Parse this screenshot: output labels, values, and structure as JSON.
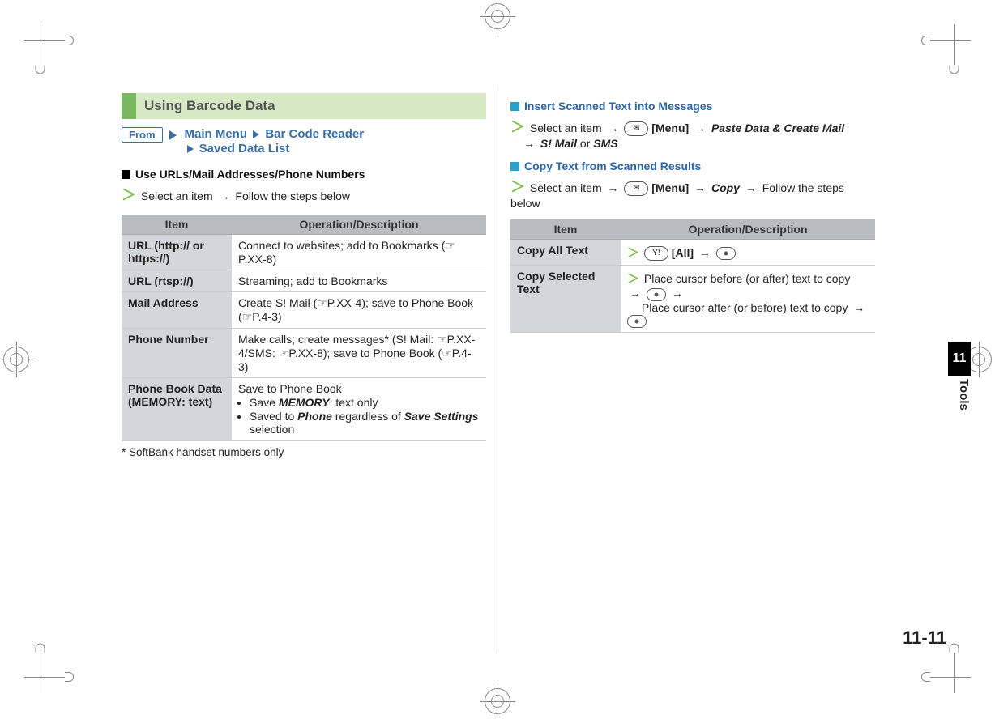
{
  "chapter": {
    "number": "11",
    "side_label": "Tools"
  },
  "page_number": "11-11",
  "section_title": "Using Barcode Data",
  "from_label": "From",
  "nav": {
    "a": "Main Menu",
    "b": "Bar Code Reader",
    "c": "Saved Data List"
  },
  "left": {
    "sub1": "Use URLs/Mail Addresses/Phone Numbers",
    "step1_a": "Select an item",
    "step1_b": "Follow the steps below",
    "footnote_mark": "*",
    "footnote": " SoftBank handset numbers only",
    "table": {
      "head_item": "Item",
      "head_desc": "Operation/Description",
      "rows": [
        {
          "item": "URL (http:// or https://)",
          "desc": "Connect to websites; add to Bookmarks (☞P.XX-8)"
        },
        {
          "item": "URL (rtsp://)",
          "desc": "Streaming; add to Bookmarks"
        },
        {
          "item": "Mail Address",
          "desc": "Create S! Mail (☞P.XX-4); save to Phone Book (☞P.4-3)"
        },
        {
          "item": "Phone Number",
          "desc": "Make calls; create messages* (S! Mail: ☞P.XX-4/SMS: ☞P.XX-8); save to Phone Book (☞P.4-3)"
        },
        {
          "item": "Phone Book Data (MEMORY: text)",
          "desc_lead": "Save to Phone Book",
          "desc_b1_a": "Save ",
          "desc_b1_b": "MEMORY",
          "desc_b1_c": ": text only",
          "desc_b2_a": "Saved to ",
          "desc_b2_b": "Phone",
          "desc_b2_c": " regardless of ",
          "desc_b2_d": "Save Settings",
          "desc_b2_e": " selection"
        }
      ]
    }
  },
  "right": {
    "sub_a": "Insert Scanned Text into Messages",
    "a_step_1": "Select an item",
    "a_menu": "[Menu]",
    "a_paste": "Paste Data & Create Mail",
    "a_smail": "S! Mail",
    "a_or": " or ",
    "a_sms": "SMS",
    "sub_b": "Copy Text from Scanned Results",
    "b_step_1": "Select an item",
    "b_menu": "[Menu]",
    "b_copy": "Copy",
    "b_step_2": "Follow the steps below",
    "table": {
      "head_item": "Item",
      "head_desc": "Operation/Description",
      "rows": [
        {
          "item": "Copy All Text",
          "all_label": "[All]"
        },
        {
          "item": "Copy Selected Text",
          "sel_a": "Place cursor before (or after) text to copy",
          "sel_b": "Place cursor after (or before) text to copy"
        }
      ]
    }
  },
  "glyphs": {
    "mail_key": "✉",
    "y_key": "Y!"
  }
}
